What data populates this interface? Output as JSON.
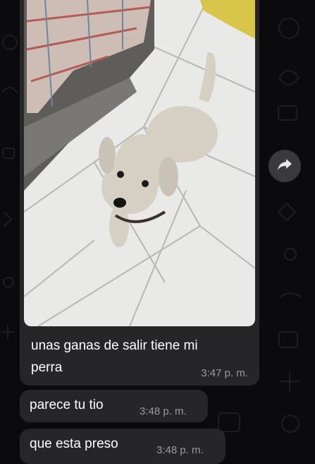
{
  "chat": {
    "messages": [
      {
        "type": "image",
        "caption": "unas ganas de salir tiene mi perra",
        "caption_line1": "unas ganas de salir tiene mi",
        "caption_line2": "perra",
        "time": "3:47 p. m."
      },
      {
        "type": "text",
        "text": "parece tu tio",
        "time": "3:48 p. m."
      },
      {
        "type": "text",
        "text": "que esta preso",
        "time": "3:48 p. m."
      }
    ],
    "forward_icon": "forward-arrow-icon"
  },
  "colors": {
    "background": "#0b0b0d",
    "bubble": "#262628",
    "timestamp": "#9a9a9e",
    "forward_button": "#3a3a3d"
  }
}
